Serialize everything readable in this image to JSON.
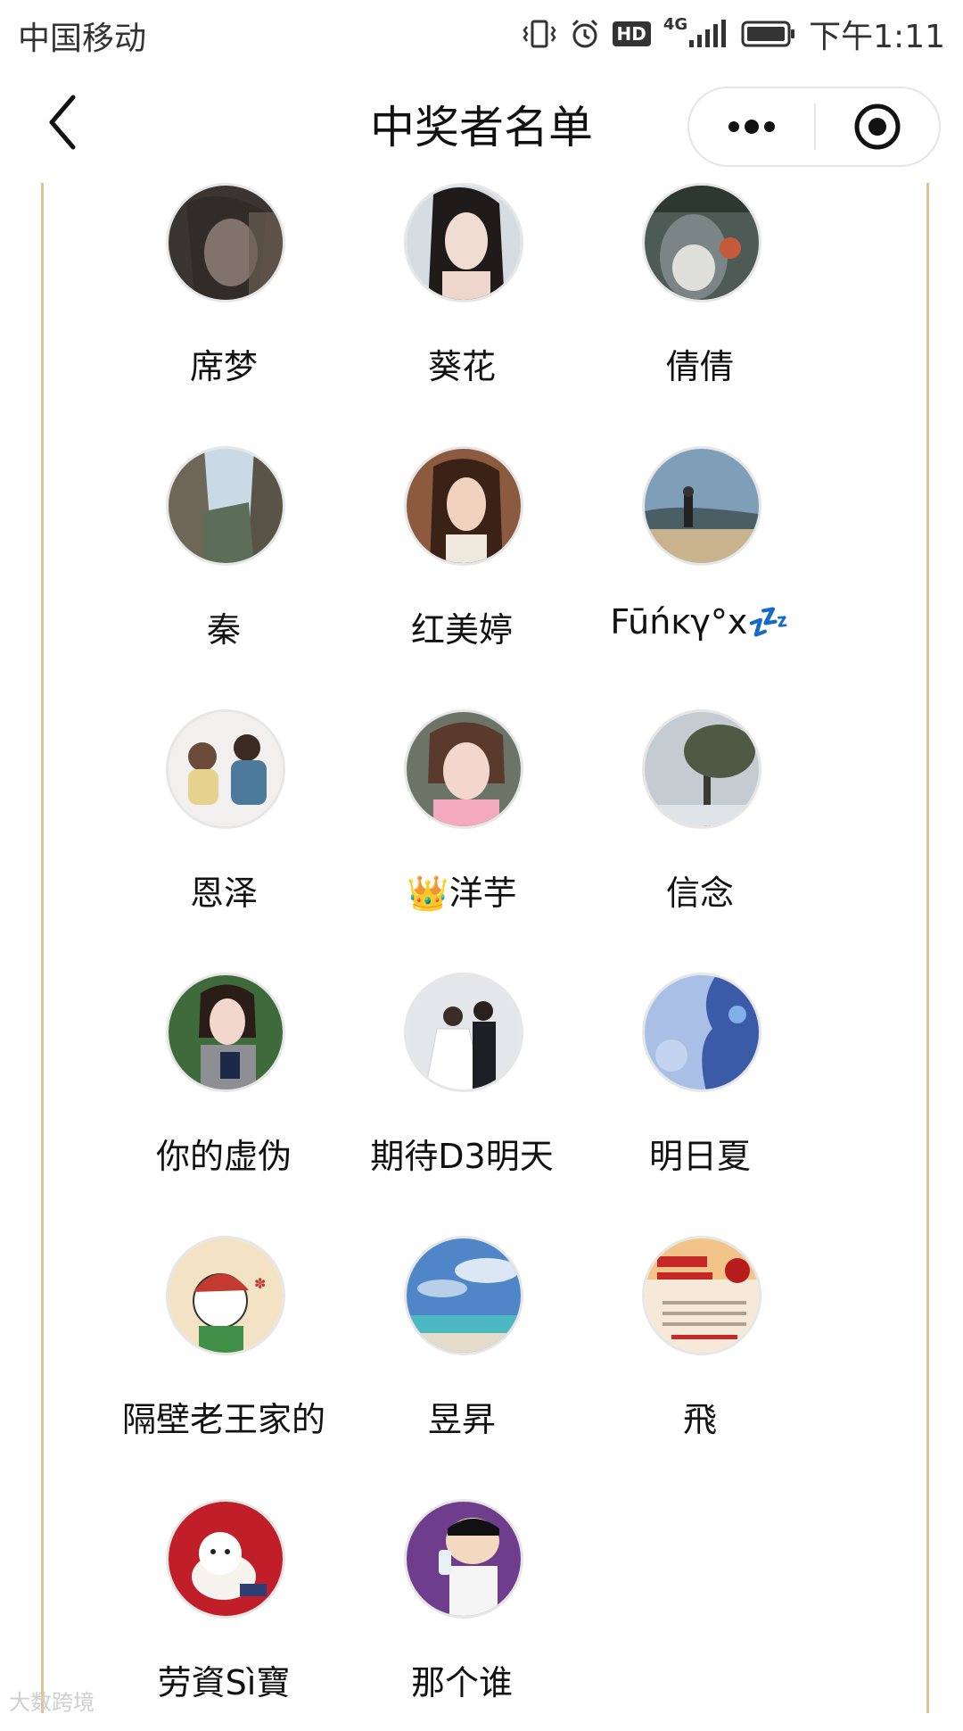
{
  "status_bar": {
    "carrier": "中国移动",
    "network": "4G",
    "hd": "HD",
    "time": "下午1:11",
    "icons": [
      "vibrate-icon",
      "alarm-icon",
      "hd-icon",
      "signal-icon",
      "battery-icon"
    ]
  },
  "nav": {
    "title": "中奖者名单",
    "back_icon": "chevron-left-icon",
    "more_icon": "more-dots-icon",
    "close_icon": "target-close-icon"
  },
  "winners": [
    {
      "name": "席梦",
      "avatar": "avatar-photo"
    },
    {
      "name": "葵花",
      "avatar": "avatar-photo"
    },
    {
      "name": "倩倩",
      "avatar": "avatar-totoro"
    },
    {
      "name": "秦",
      "avatar": "avatar-mountain"
    },
    {
      "name": "红美婷",
      "avatar": "avatar-photo"
    },
    {
      "name": "Fūńĸγ°x💤",
      "avatar": "avatar-beach"
    },
    {
      "name": "恩泽",
      "avatar": "avatar-kids"
    },
    {
      "name": "👑洋芋",
      "avatar": "avatar-photo"
    },
    {
      "name": "信念",
      "avatar": "avatar-tree"
    },
    {
      "name": "你的虚伪",
      "avatar": "avatar-photo"
    },
    {
      "name": "期待D3明天",
      "avatar": "avatar-wedding"
    },
    {
      "name": "明日夏",
      "avatar": "avatar-blue-silhouette"
    },
    {
      "name": "隔壁老王家的",
      "avatar": "avatar-cartoon"
    },
    {
      "name": "昱昇",
      "avatar": "avatar-sky-sea"
    },
    {
      "name": "飛",
      "avatar": "avatar-poster"
    },
    {
      "name": "劳資Sì寶",
      "avatar": "avatar-puppy"
    },
    {
      "name": "那个谁",
      "avatar": "avatar-crayon"
    }
  ],
  "colors": {
    "frame_border": "#d7c68f",
    "text": "#111111",
    "avatar_ring": "#e6e6e6"
  },
  "watermark": "大数跨境"
}
